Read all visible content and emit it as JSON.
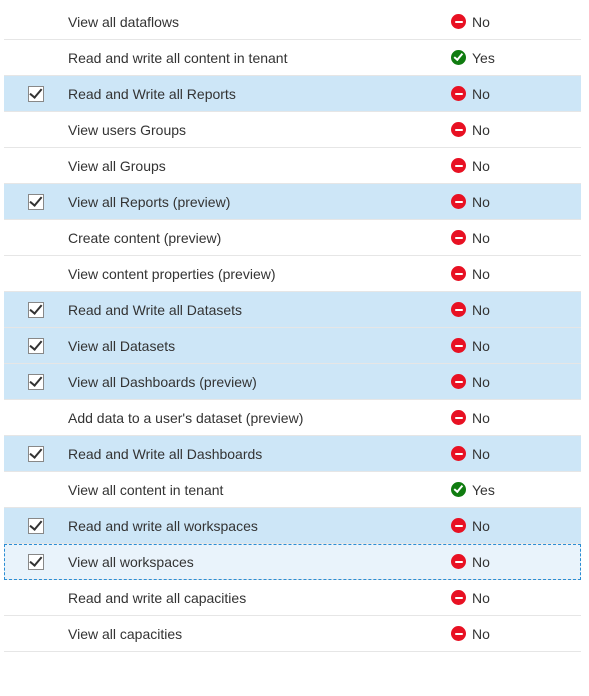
{
  "status_labels": {
    "yes": "Yes",
    "no": "No"
  },
  "rows": [
    {
      "label": "View all dataflows",
      "granted": false,
      "selected": false,
      "focused": false,
      "hover": false
    },
    {
      "label": "Read and write all content in tenant",
      "granted": true,
      "selected": false,
      "focused": false,
      "hover": false
    },
    {
      "label": "Read and Write all Reports",
      "granted": false,
      "selected": true,
      "focused": false,
      "hover": false
    },
    {
      "label": "View users Groups",
      "granted": false,
      "selected": false,
      "focused": false,
      "hover": false
    },
    {
      "label": "View all Groups",
      "granted": false,
      "selected": false,
      "focused": false,
      "hover": false
    },
    {
      "label": "View all Reports (preview)",
      "granted": false,
      "selected": true,
      "focused": false,
      "hover": false
    },
    {
      "label": "Create content (preview)",
      "granted": false,
      "selected": false,
      "focused": false,
      "hover": false
    },
    {
      "label": "View content properties (preview)",
      "granted": false,
      "selected": false,
      "focused": false,
      "hover": false
    },
    {
      "label": "Read and Write all Datasets",
      "granted": false,
      "selected": true,
      "focused": false,
      "hover": false
    },
    {
      "label": "View all Datasets",
      "granted": false,
      "selected": true,
      "focused": false,
      "hover": true
    },
    {
      "label": "View all Dashboards (preview)",
      "granted": false,
      "selected": true,
      "focused": false,
      "hover": false
    },
    {
      "label": "Add data to a user's dataset (preview)",
      "granted": false,
      "selected": false,
      "focused": false,
      "hover": false
    },
    {
      "label": "Read and Write all Dashboards",
      "granted": false,
      "selected": true,
      "focused": false,
      "hover": false
    },
    {
      "label": "View all content in tenant",
      "granted": true,
      "selected": false,
      "focused": false,
      "hover": false
    },
    {
      "label": "Read and write all workspaces",
      "granted": false,
      "selected": true,
      "focused": false,
      "hover": false
    },
    {
      "label": "View all workspaces",
      "granted": false,
      "selected": true,
      "focused": true,
      "hover": false
    },
    {
      "label": "Read and write all capacities",
      "granted": false,
      "selected": false,
      "focused": false,
      "hover": false
    },
    {
      "label": "View all capacities",
      "granted": false,
      "selected": false,
      "focused": false,
      "hover": false
    }
  ]
}
